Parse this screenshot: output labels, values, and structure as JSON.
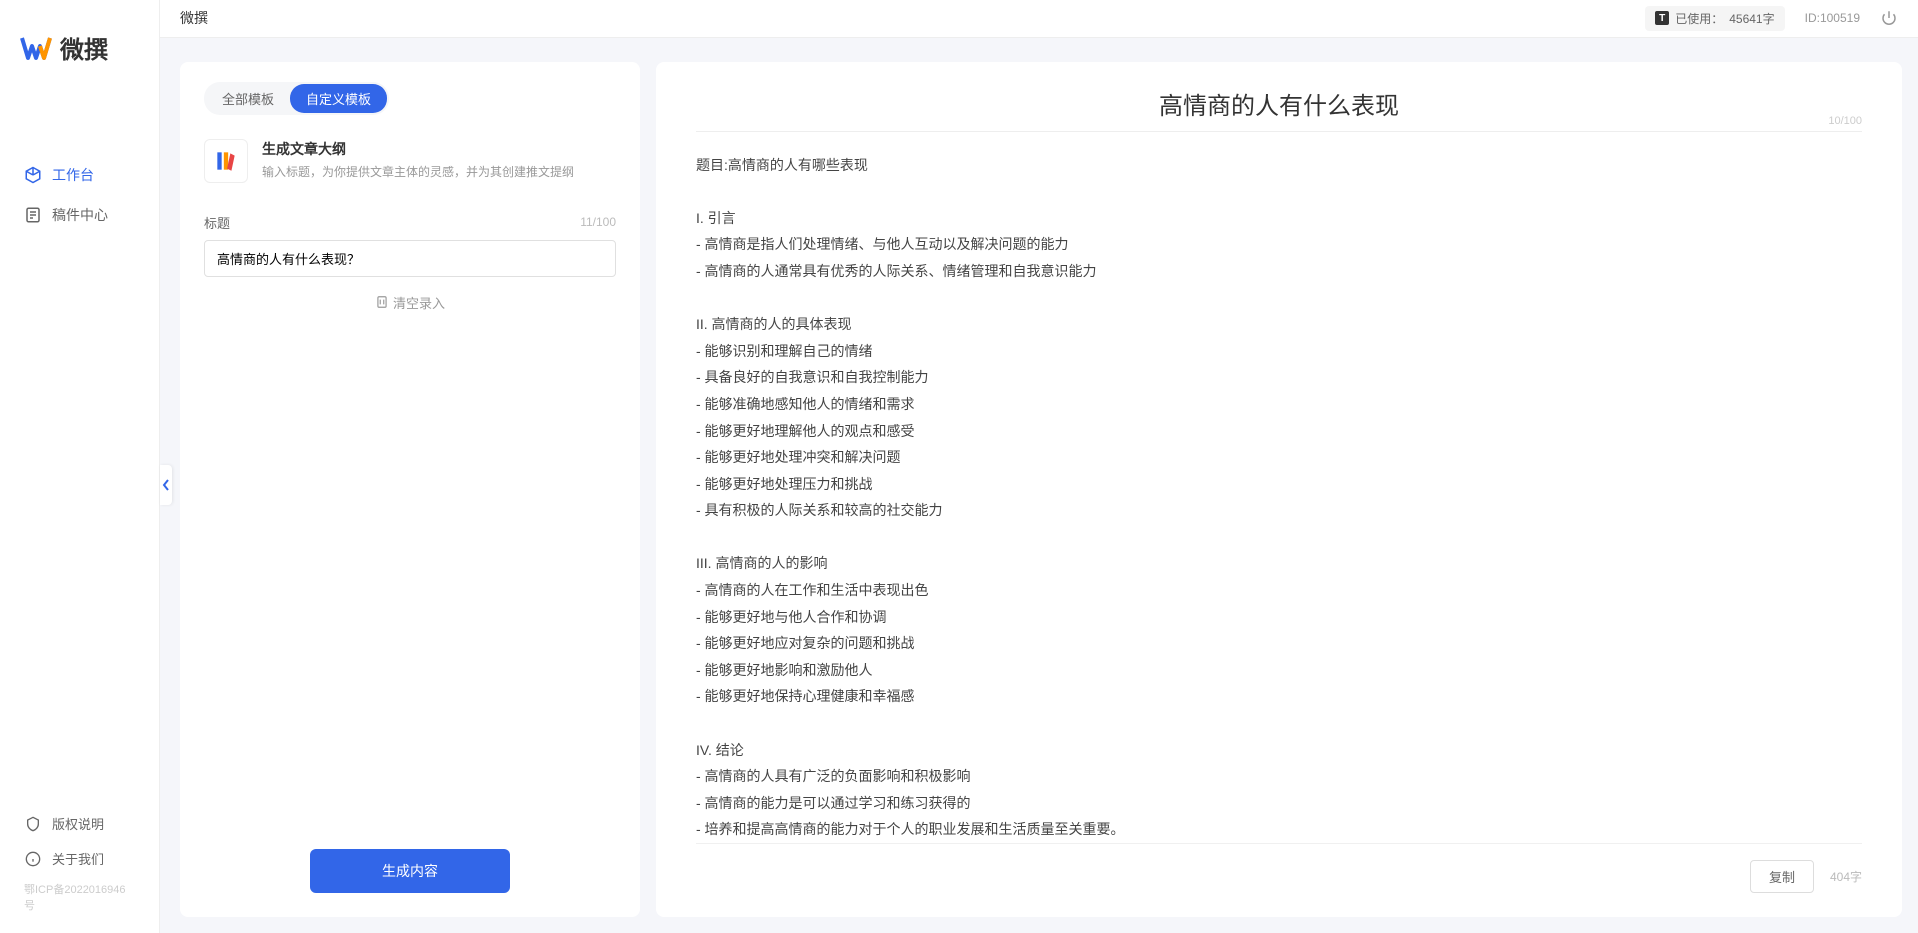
{
  "app_name": "微撰",
  "topbar": {
    "title": "微撰",
    "usage_label": "已使用：",
    "usage_value": "45641字",
    "user_id": "ID:100519"
  },
  "sidebar": {
    "nav": [
      {
        "label": "工作台",
        "active": true
      },
      {
        "label": "稿件中心",
        "active": false
      }
    ],
    "bottom": [
      {
        "label": "版权说明"
      },
      {
        "label": "关于我们"
      }
    ],
    "icp": "鄂ICP备2022016946号"
  },
  "left_panel": {
    "tabs": [
      {
        "label": "全部模板",
        "active": false
      },
      {
        "label": "自定义模板",
        "active": true
      }
    ],
    "template": {
      "title": "生成文章大纲",
      "desc": "输入标题，为你提供文章主体的灵感，并为其创建推文提纲"
    },
    "form": {
      "title_label": "标题",
      "char_count": "11/100",
      "title_value": "高情商的人有什么表现？",
      "clear_label": "清空录入"
    },
    "generate_label": "生成内容"
  },
  "output": {
    "title": "高情商的人有什么表现",
    "title_count": "10/100",
    "body": "题目:高情商的人有哪些表现\n\nI. 引言\n- 高情商是指人们处理情绪、与他人互动以及解决问题的能力\n- 高情商的人通常具有优秀的人际关系、情绪管理和自我意识能力\n\nII. 高情商的人的具体表现\n- 能够识别和理解自己的情绪\n- 具备良好的自我意识和自我控制能力\n- 能够准确地感知他人的情绪和需求\n- 能够更好地理解他人的观点和感受\n- 能够更好地处理冲突和解决问题\n- 能够更好地处理压力和挑战\n- 具有积极的人际关系和较高的社交能力\n\nIII. 高情商的人的影响\n- 高情商的人在工作和生活中表现出色\n- 能够更好地与他人合作和协调\n- 能够更好地应对复杂的问题和挑战\n- 能够更好地影响和激励他人\n- 能够更好地保持心理健康和幸福感\n\nIV. 结论\n- 高情商的人具有广泛的负面影响和积极影响\n- 高情商的能力是可以通过学习和练习获得的\n- 培养和提高高情商的能力对于个人的职业发展和生活质量至关重要。",
    "copy_label": "复制",
    "word_count": "404字"
  }
}
